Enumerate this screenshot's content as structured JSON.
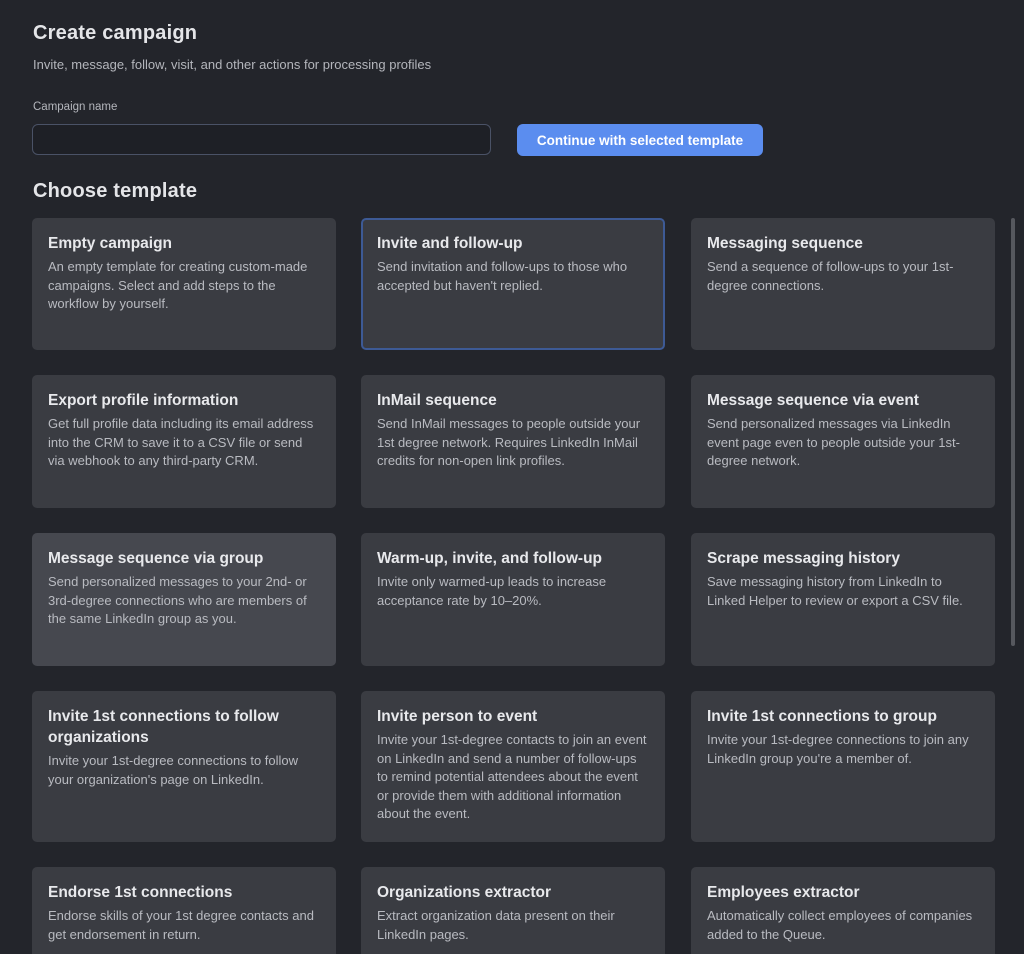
{
  "header": {
    "title": "Create campaign",
    "subtitle": "Invite, message, follow, visit, and other actions for processing profiles"
  },
  "form": {
    "campaign_name_label": "Campaign name",
    "campaign_name_value": "",
    "continue_label": "Continue with selected template"
  },
  "templates": {
    "section_title": "Choose template",
    "selected": "Invite and follow-up",
    "items": [
      {
        "title": "Empty campaign",
        "description": "An empty template for creating custom-made campaigns. Select and add steps to the workflow by yourself."
      },
      {
        "title": "Invite and follow-up",
        "description": "Send invitation and follow-ups to those who accepted but haven't replied."
      },
      {
        "title": "Messaging sequence",
        "description": "Send a sequence of follow-ups to your 1st-degree connections."
      },
      {
        "title": "Export profile information",
        "description": "Get full profile data including its email address into the CRM to save it to a CSV file or send via webhook to any third-party CRM."
      },
      {
        "title": "InMail sequence",
        "description": "Send InMail messages to people outside your 1st degree network. Requires LinkedIn InMail credits for non-open link profiles."
      },
      {
        "title": "Message sequence via event",
        "description": "Send personalized messages via LinkedIn event page even to people outside your 1st-degree network."
      },
      {
        "title": "Message sequence via group",
        "description": "Send personalized messages to your 2nd- or 3rd-degree connections who are members of the same LinkedIn group as you."
      },
      {
        "title": "Warm-up, invite, and follow-up",
        "description": "Invite only warmed-up leads to increase acceptance rate by 10–20%."
      },
      {
        "title": "Scrape messaging history",
        "description": "Save messaging history from LinkedIn to Linked Helper to review or export a CSV file."
      },
      {
        "title": "Invite 1st connections to follow organizations",
        "description": "Invite your 1st-degree connections to follow your organization's page on LinkedIn."
      },
      {
        "title": "Invite person to event",
        "description": "Invite your 1st-degree contacts to join an event on LinkedIn and send a number of follow-ups to remind potential attendees about the event or provide them with additional information about the event."
      },
      {
        "title": "Invite 1st connections to group",
        "description": "Invite your 1st-degree connections to join any LinkedIn group you're a member of."
      },
      {
        "title": "Endorse 1st connections",
        "description": "Endorse skills of your 1st degree contacts and get endorsement in return."
      },
      {
        "title": "Organizations extractor",
        "description": "Extract organization data present on their LinkedIn pages."
      },
      {
        "title": "Employees extractor",
        "description": "Automatically collect employees of companies added to the Queue."
      }
    ]
  },
  "colors": {
    "background": "#23252b",
    "card": "#3a3c42",
    "card_hover": "#46484f",
    "selected_border": "#3d5a95",
    "accent_button": "#5b8def"
  }
}
